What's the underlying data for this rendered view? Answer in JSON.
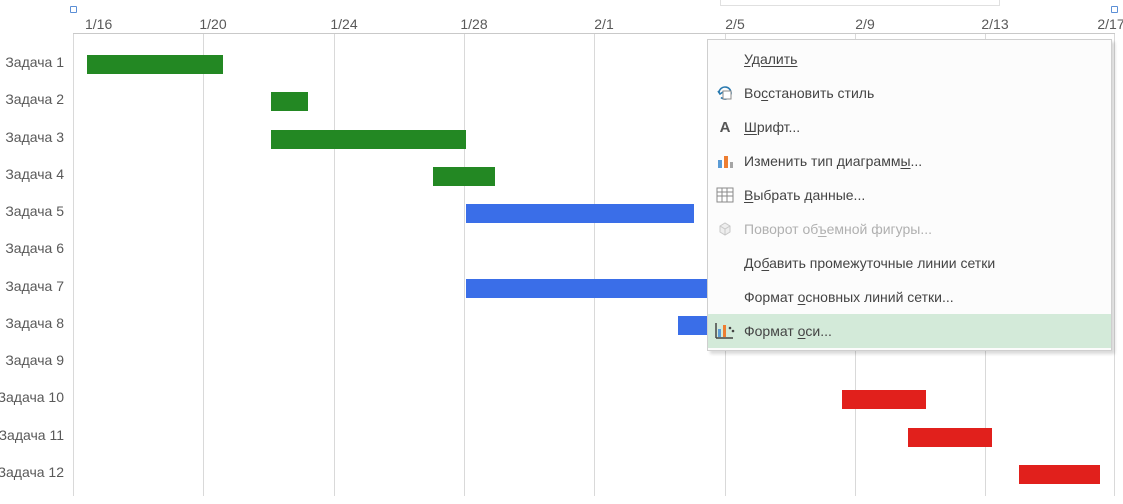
{
  "axis": {
    "ticks": [
      "1/16",
      "1/20",
      "1/24",
      "1/28",
      "2/1",
      "2/5",
      "2/9",
      "2/13",
      "2/17"
    ]
  },
  "tasks": [
    {
      "label": "Задача 1"
    },
    {
      "label": "Задача 2"
    },
    {
      "label": "Задача 3"
    },
    {
      "label": "Задача 4"
    },
    {
      "label": "Задача 5"
    },
    {
      "label": "Задача 6"
    },
    {
      "label": "Задача 7"
    },
    {
      "label": "Задача 8"
    },
    {
      "label": "Задача 9"
    },
    {
      "label": "Задача 10"
    },
    {
      "label": "Задача 11"
    },
    {
      "label": "Задача 12"
    }
  ],
  "menu": {
    "delete": "Удалить",
    "reset": "Восстановить стиль",
    "reset_u": "с",
    "font": "Шрифт...",
    "font_u": "Ш",
    "change_type": "Изменить тип диаграммы...",
    "change_type_u": "ы",
    "select_data": "Выбрать данные...",
    "select_data_u": "В",
    "rotate3d": "Поворот объемной фигуры...",
    "rotate3d_u": "ъ",
    "add_minor": "Добавить промежуточные линии сетки",
    "add_minor_u": "б",
    "format_major": "Формат основных линий сетки...",
    "format_major_u": "о",
    "format_axis": "Формат оси...",
    "format_axis_u": "о"
  },
  "chart_data": {
    "type": "bar",
    "title": "",
    "xlabel": "",
    "ylabel": "",
    "x_ticks": [
      "1/16",
      "1/20",
      "1/24",
      "1/28",
      "2/1",
      "2/5",
      "2/9",
      "2/13",
      "2/17"
    ],
    "x_range_days": [
      0,
      32
    ],
    "series": [
      {
        "name": "green",
        "color": "#238823",
        "bars": [
          {
            "task": "Задача 1",
            "start_day": 0,
            "duration": 5
          },
          {
            "task": "Задача 2",
            "start_day": 6,
            "duration": 1
          },
          {
            "task": "Задача 3",
            "start_day": 6,
            "duration": 6
          },
          {
            "task": "Задача 4",
            "start_day": 11,
            "duration": 2
          }
        ]
      },
      {
        "name": "blue",
        "color": "#3a6ee8",
        "bars": [
          {
            "task": "Задача 5",
            "start_day": 12,
            "duration": 7
          },
          {
            "task": "Задача 7",
            "start_day": 12,
            "duration": 10
          },
          {
            "task": "Задача 8",
            "start_day": 19,
            "duration": 1
          }
        ]
      },
      {
        "name": "red",
        "color": "#e1201c",
        "bars": [
          {
            "task": "Задача 10",
            "start_day": 24,
            "duration": 2.5
          },
          {
            "task": "Задача 11",
            "start_day": 26.5,
            "duration": 2.5
          },
          {
            "task": "Задача 12",
            "start_day": 29.5,
            "duration": 2.5
          }
        ]
      }
    ]
  }
}
